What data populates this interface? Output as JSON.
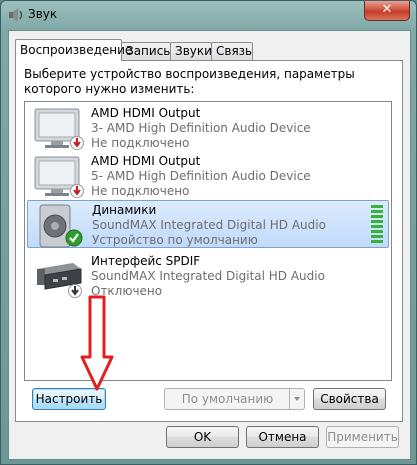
{
  "window": {
    "title": "Звук",
    "close_label": "✕"
  },
  "tabs": [
    {
      "label": "Воспроизведение",
      "active": true
    },
    {
      "label": "Запись",
      "active": false
    },
    {
      "label": "Звуки",
      "active": false
    },
    {
      "label": "Связь",
      "active": false
    }
  ],
  "instruction": "Выберите устройство воспроизведения, параметры которого нужно изменить:",
  "devices": [
    {
      "name": "AMD HDMI Output",
      "description": "3- AMD High Definition Audio Device",
      "status": "Не подключено",
      "icon": "monitor-icon",
      "badge": "disconnected-badge-icon",
      "selected": false
    },
    {
      "name": "AMD HDMI Output",
      "description": "5- AMD High Definition Audio Device",
      "status": "Не подключено",
      "icon": "monitor-icon",
      "badge": "disconnected-badge-icon",
      "selected": false
    },
    {
      "name": "Динамики",
      "description": "SoundMAX Integrated Digital HD Audio",
      "status": "Устройство по умолчанию",
      "icon": "speaker-icon",
      "badge": "default-check-icon",
      "selected": true,
      "level_segments_lit": 8
    },
    {
      "name": "Интерфейс SPDIF",
      "description": "SoundMAX Integrated Digital HD Audio",
      "status": "Отключено",
      "icon": "spdif-device-icon",
      "badge": "disabled-badge-icon",
      "selected": false
    }
  ],
  "buttons": {
    "configure": "Настроить",
    "default": "По умолчанию",
    "properties": "Свойства",
    "ok": "OK",
    "cancel": "Отмена",
    "apply": "Применить"
  },
  "colors": {
    "annotation_arrow": "#e02020",
    "selection": "#c1dbfc",
    "level_meter": "#38b238"
  }
}
